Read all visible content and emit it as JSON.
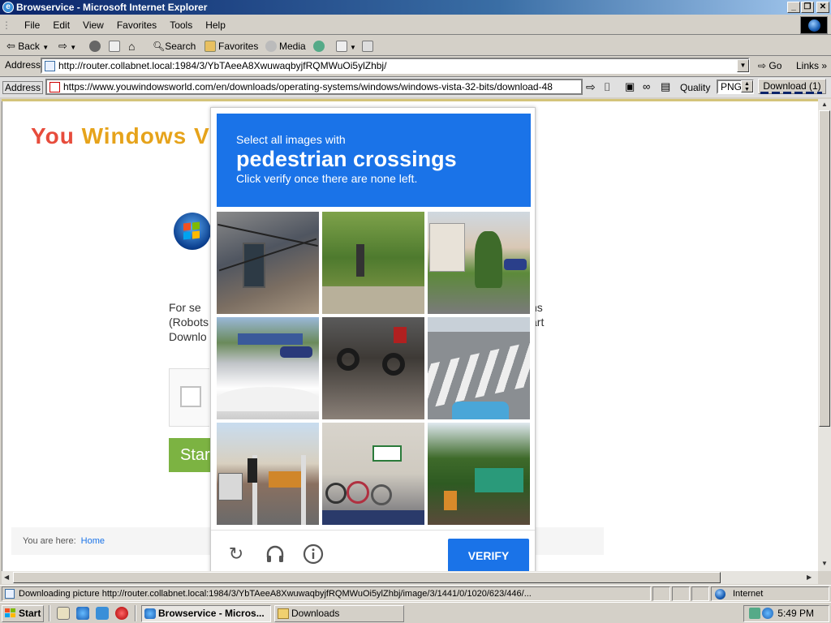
{
  "window": {
    "title": "Browservice - Microsoft Internet Explorer",
    "controls": {
      "minimize": "_",
      "restore": "❐",
      "close": "✕"
    }
  },
  "menu": [
    "File",
    "Edit",
    "View",
    "Favorites",
    "Tools",
    "Help"
  ],
  "toolbar": {
    "back": "Back",
    "search": "Search",
    "favorites": "Favorites",
    "media": "Media"
  },
  "address_bar": {
    "label": "Address",
    "url": "http://router.collabnet.local:1984/3/YbTAeeA8XwuwaqbyjfRQMWuOi5ylZhbj/",
    "go": "Go",
    "links": "Links",
    "links_arrow": "»"
  },
  "browservice_bar": {
    "label": "Address",
    "url": "https://www.youwindowsworld.com/en/downloads/operating-systems/windows/windows-vista-32-bits/download-48",
    "quality_label": "Quality",
    "quality_value": "PNG",
    "download_label": "Download (1)"
  },
  "page": {
    "logo_you": "You",
    "logo_windows": "Windows",
    "logo_partial": "V",
    "text_left": [
      "For se",
      "(Robots",
      "Downlo"
    ],
    "text_right": [
      "ns",
      "art"
    ],
    "start_button": "Star",
    "breadcrumb_label": "You are here:",
    "breadcrumb_home": "Home"
  },
  "captcha": {
    "prompt_line1": "Select all images with",
    "prompt_target": "pedestrian crossings",
    "prompt_line3": "Click verify once there are none left.",
    "verify_label": "VERIFY",
    "icons": [
      "reload-icon",
      "audio-icon",
      "info-icon"
    ],
    "tiles": [
      {
        "subject": "utility pole with cables and meter"
      },
      {
        "subject": "trees and bushes along a path"
      },
      {
        "subject": "houses and shrubs on a street"
      },
      {
        "subject": "cars on a street with a bus"
      },
      {
        "subject": "parked motorcycles"
      },
      {
        "subject": "pedestrian crossing stripes"
      },
      {
        "subject": "street with traffic light and trucks"
      },
      {
        "subject": "bicycles parked by a building"
      },
      {
        "subject": "trees and a green tent"
      }
    ]
  },
  "status_bar": {
    "text": "Downloading picture http://router.collabnet.local:1984/3/YbTAeeA8XwuwaqbyjfRQMWuOi5ylZhbj/image/3/1441/0/1020/623/446/...",
    "zone": "Internet"
  },
  "taskbar": {
    "start": "Start",
    "tasks": [
      "Browservice - Micros...",
      "Downloads"
    ],
    "clock": "5:49 PM"
  }
}
